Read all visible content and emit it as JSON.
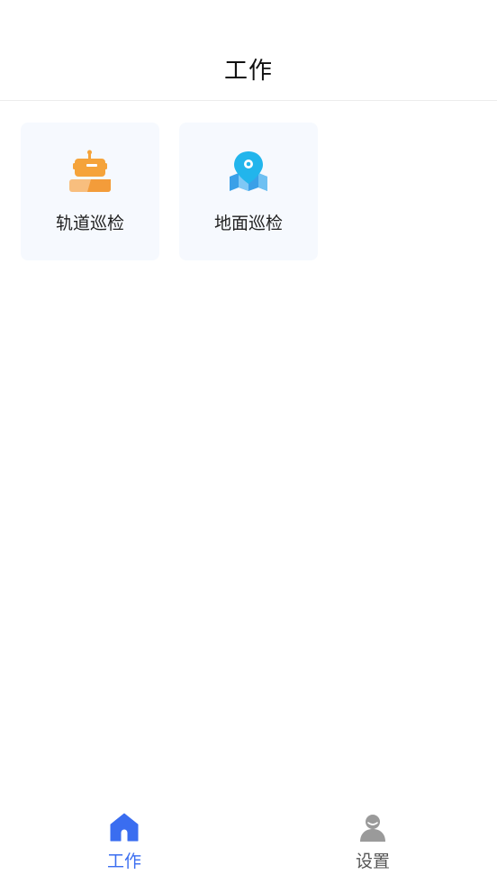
{
  "header": {
    "title": "工作"
  },
  "cards": [
    {
      "label": "轨道巡检",
      "icon": "robot-rail-icon",
      "color": "#f5a33a"
    },
    {
      "label": "地面巡检",
      "icon": "map-pin-icon",
      "color": "#2aa8ee"
    }
  ],
  "tabbar": {
    "tabs": [
      {
        "label": "工作",
        "icon": "home-icon",
        "active": true,
        "color": "#3a6df0"
      },
      {
        "label": "设置",
        "icon": "user-icon",
        "active": false,
        "color": "#9a9a9a"
      }
    ]
  }
}
